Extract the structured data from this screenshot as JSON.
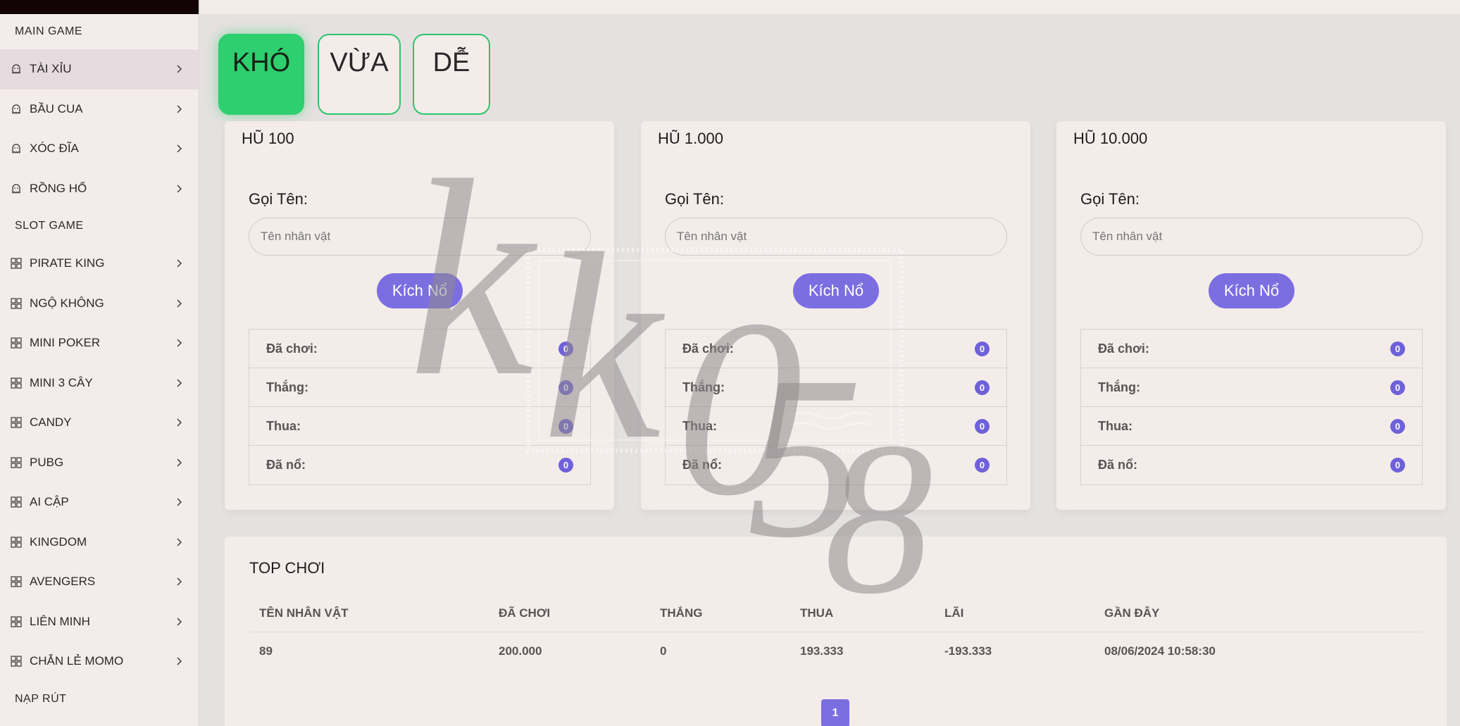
{
  "sidebar": {
    "sections": [
      {
        "title": "MAIN GAME",
        "items": [
          {
            "label": "TÀI XỈU",
            "icon": "ghost-icon",
            "active": true
          },
          {
            "label": "BẦU CUA",
            "icon": "ghost-icon"
          },
          {
            "label": "XÓC ĐĨA",
            "icon": "ghost-icon"
          },
          {
            "label": "RỒNG HỔ",
            "icon": "ghost-icon"
          }
        ]
      },
      {
        "title": "SLOT GAME",
        "items": [
          {
            "label": "PIRATE KING",
            "icon": "grid-icon"
          },
          {
            "label": "NGỘ KHÔNG",
            "icon": "grid-icon"
          },
          {
            "label": "MINI POKER",
            "icon": "grid-icon"
          },
          {
            "label": "MINI 3 CÂY",
            "icon": "grid-icon"
          },
          {
            "label": "CANDY",
            "icon": "grid-icon"
          },
          {
            "label": "PUBG",
            "icon": "grid-icon"
          },
          {
            "label": "AI CẬP",
            "icon": "grid-icon"
          },
          {
            "label": "KINGDOM",
            "icon": "grid-icon"
          },
          {
            "label": "AVENGERS",
            "icon": "grid-icon"
          },
          {
            "label": "LIÊN MINH",
            "icon": "grid-icon"
          },
          {
            "label": "CHẴN LẺ MOMO",
            "icon": "grid-icon"
          }
        ]
      },
      {
        "title": "NẠP RÚT",
        "items": []
      }
    ]
  },
  "tabs": [
    {
      "label": "KHÓ",
      "active": true
    },
    {
      "label": "VỪA",
      "active": false
    },
    {
      "label": "DỄ",
      "active": false
    }
  ],
  "cards": [
    {
      "title": "HŨ 100",
      "name_label": "Gọi Tên:",
      "placeholder": "Tên nhân vật",
      "button": "Kích Nổ",
      "stats": [
        {
          "label": "Đã chơi:",
          "value": "0"
        },
        {
          "label": "Thắng:",
          "value": "0"
        },
        {
          "label": "Thua:",
          "value": "0"
        },
        {
          "label": "Đã nổ:",
          "value": "0"
        }
      ]
    },
    {
      "title": "HŨ 1.000",
      "name_label": "Gọi Tên:",
      "placeholder": "Tên nhân vật",
      "button": "Kích Nổ",
      "stats": [
        {
          "label": "Đã chơi:",
          "value": "0"
        },
        {
          "label": "Thắng:",
          "value": "0"
        },
        {
          "label": "Thua:",
          "value": "0"
        },
        {
          "label": "Đã nổ:",
          "value": "0"
        }
      ]
    },
    {
      "title": "HŨ 10.000",
      "name_label": "Gọi Tên:",
      "placeholder": "Tên nhân vật",
      "button": "Kích Nổ",
      "stats": [
        {
          "label": "Đã chơi:",
          "value": "0"
        },
        {
          "label": "Thắng:",
          "value": "0"
        },
        {
          "label": "Thua:",
          "value": "0"
        },
        {
          "label": "Đã nổ:",
          "value": "0"
        }
      ]
    }
  ],
  "top": {
    "title": "TOP CHƠI",
    "columns": [
      "TÊN NHÂN VẬT",
      "ĐÃ CHƠI",
      "THẮNG",
      "THUA",
      "LÃI",
      "GẦN ĐÂY"
    ],
    "rows": [
      [
        "89",
        "200.000",
        "0",
        "193.333",
        "-193.333",
        "08/06/2024 10:58:30"
      ]
    ],
    "page": "1"
  },
  "watermark": {
    "text": "KK058"
  },
  "colors": {
    "accent": "#7b6ee1",
    "active_tab": "#2ecf6e",
    "badge": "#6f61d9"
  }
}
